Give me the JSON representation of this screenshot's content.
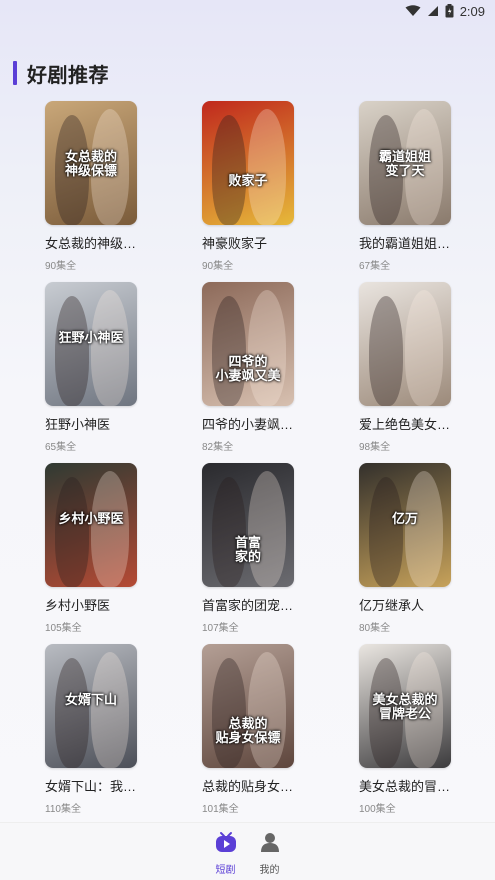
{
  "status_bar": {
    "time": "2:09"
  },
  "section": {
    "title": "好剧推荐"
  },
  "dramas": [
    {
      "title": "女总裁的神级…",
      "episodes": "90集全",
      "caption": "女总裁的\n神级保镖",
      "bg": "#c9a779",
      "bg2": "#7a5b3a"
    },
    {
      "title": "神豪败家子",
      "episodes": "90集全",
      "caption": "败家子",
      "bg": "#c0281d",
      "bg2": "#e6b93a"
    },
    {
      "title": "我的霸道姐姐…",
      "episodes": "67集全",
      "caption": "霸道姐姐\n变了天",
      "bg": "#d9d2c8",
      "bg2": "#8a7a6c"
    },
    {
      "title": "狂野小神医",
      "episodes": "65集全",
      "caption": "狂野小神医",
      "bg": "#c8ccd2",
      "bg2": "#6f7580"
    },
    {
      "title": "四爷的小妻飒…",
      "episodes": "82集全",
      "caption": "四爷的\n小妻飒又美",
      "bg": "#8d6a5a",
      "bg2": "#d7c0b0"
    },
    {
      "title": "爱上绝色美女…",
      "episodes": "98集全",
      "caption": "",
      "bg": "#e9e4df",
      "bg2": "#9c8a7a"
    },
    {
      "title": "乡村小野医",
      "episodes": "105集全",
      "caption": "乡村小野医",
      "bg": "#2f3a33",
      "bg2": "#b54a34"
    },
    {
      "title": "首富家的团宠…",
      "episodes": "107集全",
      "caption": "首富\n家的",
      "bg": "#2a2a2e",
      "bg2": "#6b6b70"
    },
    {
      "title": "亿万继承人",
      "episodes": "80集全",
      "caption": "亿万",
      "bg": "#33302c",
      "bg2": "#c7a25a"
    },
    {
      "title": "女婿下山：我…",
      "episodes": "110集全",
      "caption": "女婿下山",
      "bg": "#b9bcc2",
      "bg2": "#4c4f58"
    },
    {
      "title": "总裁的贴身女…",
      "episodes": "101集全",
      "caption": "总裁的\n贴身女保镖",
      "bg": "#b49f95",
      "bg2": "#5e463d"
    },
    {
      "title": "美女总裁的冒…",
      "episodes": "100集全",
      "caption": "美女总裁的\n冒牌老公",
      "bg": "#eae6e1",
      "bg2": "#3c3b3d"
    }
  ],
  "bottom_nav": [
    {
      "label": "短剧",
      "icon": "tv-play-icon",
      "active": true
    },
    {
      "label": "我的",
      "icon": "user-icon",
      "active": false
    }
  ],
  "colors": {
    "accent": "#5b3fd6"
  }
}
